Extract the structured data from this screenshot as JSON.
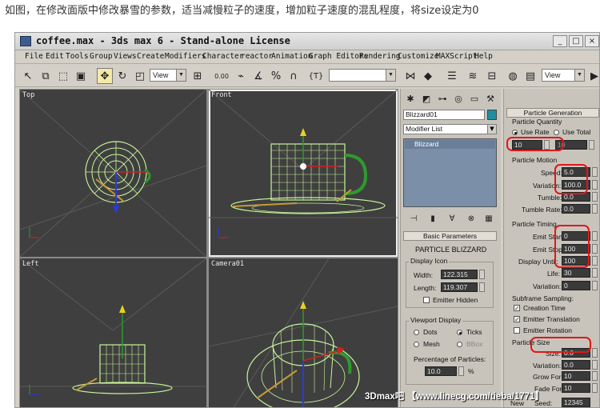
{
  "caption": "如图，在修改面版中修改暴雪的参数，适当减慢粒子的速度，增加粒子速度的混乱程度，将size设定为0",
  "window": {
    "title": "coffee.max - 3ds max 6 - Stand-alone License",
    "btn_min": "_",
    "btn_max": "□",
    "btn_close": "×"
  },
  "menu": [
    "File",
    "Edit",
    "Tools",
    "Group",
    "Views",
    "Create",
    "Modifiers",
    "Character",
    "reactor",
    "Animation",
    "Graph Editors",
    "Rendering",
    "Customize",
    "MAXScript",
    "Help"
  ],
  "toolbar": {
    "view_dropdown": "View",
    "view_dropdown_right": "View",
    "value_label": "0.00",
    "brace_label": "{Ƭ}"
  },
  "viewports": {
    "top": "Top",
    "front": "Front",
    "left": "Left",
    "camera": "Camera01"
  },
  "modify_panel": {
    "object_name": "Blizzard01",
    "modifier_list": "Modifier List",
    "stack_item": "Blizzard",
    "basic_params_header": "Basic Parameters",
    "particle_type_title": "PARTICLE BLIZZARD",
    "display_icon_title": "Display Icon",
    "width_label": "Width:",
    "width_value": "122.315",
    "length_label": "Length:",
    "length_value": "119.307",
    "emitter_hidden": "Emitter Hidden",
    "viewport_display_title": "Viewport Display",
    "dots": "Dots",
    "ticks": "Ticks",
    "mesh": "Mesh",
    "bbox": "BBox",
    "percentage_label": "Percentage of Particles:",
    "percentage_value": "10.0",
    "percent_unit": "%"
  },
  "particle_panel": {
    "header": "Particle Generation",
    "quantity_title": "Particle Quantity",
    "use_rate": "Use Rate",
    "use_total": "Use Total",
    "rate_value": "10",
    "total_value": "10",
    "motion_title": "Particle Motion",
    "speed_label": "Speed:",
    "speed_value": "5.0",
    "variation_label": "Variation:",
    "variation_value": "100.0",
    "tumble_label": "Tumble:",
    "tumble_value": "0.0",
    "tumble_rate_label": "Tumble Rate:",
    "tumble_rate_value": "0.0",
    "timing_title": "Particle Timing",
    "emit_start_label": "Emit Start:",
    "emit_start_value": "0",
    "emit_stop_label": "Emit Stop:",
    "emit_stop_value": "100",
    "display_until_label": "Display Until:",
    "display_until_value": "100",
    "life_label": "Life:",
    "life_value": "30",
    "life_variation_label": "Variation:",
    "life_variation_value": "0",
    "subframe_label": "Subframe Sampling:",
    "creation_time": "Creation Time",
    "emitter_translation": "Emitter Translation",
    "emitter_rotation": "Emitter Rotation",
    "size_title": "Particle Size",
    "size_label": "Size:",
    "size_value": "0.0",
    "size_variation_label": "Variation:",
    "size_variation_value": "0.0",
    "grow_label": "Grow For:",
    "grow_value": "10",
    "fade_label": "Fade For:",
    "fade_value": "10",
    "new_label": "New",
    "seed_label": "Seed:",
    "seed_value": "12345",
    "pct_unit": "%"
  },
  "watermark": "3Dmax吧 【www.linecg.com/tieba/1771】",
  "colors": {
    "viewport_bg": "#3f3f3f",
    "mesh_color": "#c8f59a",
    "handle_color": "#2f9a2f",
    "annotation_red": "#e01818"
  }
}
